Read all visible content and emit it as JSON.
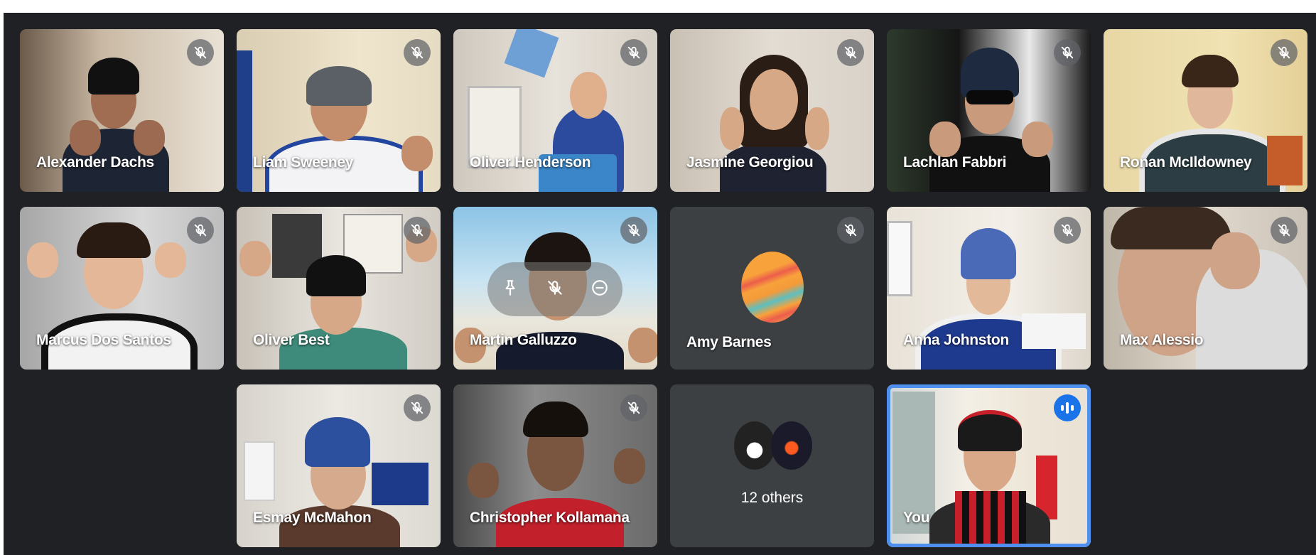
{
  "meeting": {
    "accent_color": "#1a73e8",
    "background_color": "#202124",
    "participants": [
      {
        "name": "Alexander Dachs",
        "muted": true
      },
      {
        "name": "Liam Sweeney",
        "muted": true
      },
      {
        "name": "Oliver Henderson",
        "muted": true
      },
      {
        "name": "Jasmine Georgiou",
        "muted": true
      },
      {
        "name": "Lachlan Fabbri",
        "muted": true
      },
      {
        "name": "Ronan McIldowney",
        "muted": true
      },
      {
        "name": "Marcus Dos Santos",
        "muted": true
      },
      {
        "name": "Oliver Best",
        "muted": true
      },
      {
        "name": "Martin Galluzzo",
        "muted": true,
        "hover_controls": [
          "pin-icon",
          "mic-off-icon",
          "remove-icon"
        ]
      },
      {
        "name": "Amy Barnes",
        "muted": true,
        "video": false
      },
      {
        "name": "Anna Johnston",
        "muted": true
      },
      {
        "name": "Max Alessio",
        "muted": true
      },
      {
        "name": "Esmay McMahon",
        "muted": true
      },
      {
        "name": "Christopher Kollamana",
        "muted": true
      }
    ],
    "others": {
      "label": "12 others"
    },
    "self": {
      "name": "You",
      "speaking": true
    }
  }
}
